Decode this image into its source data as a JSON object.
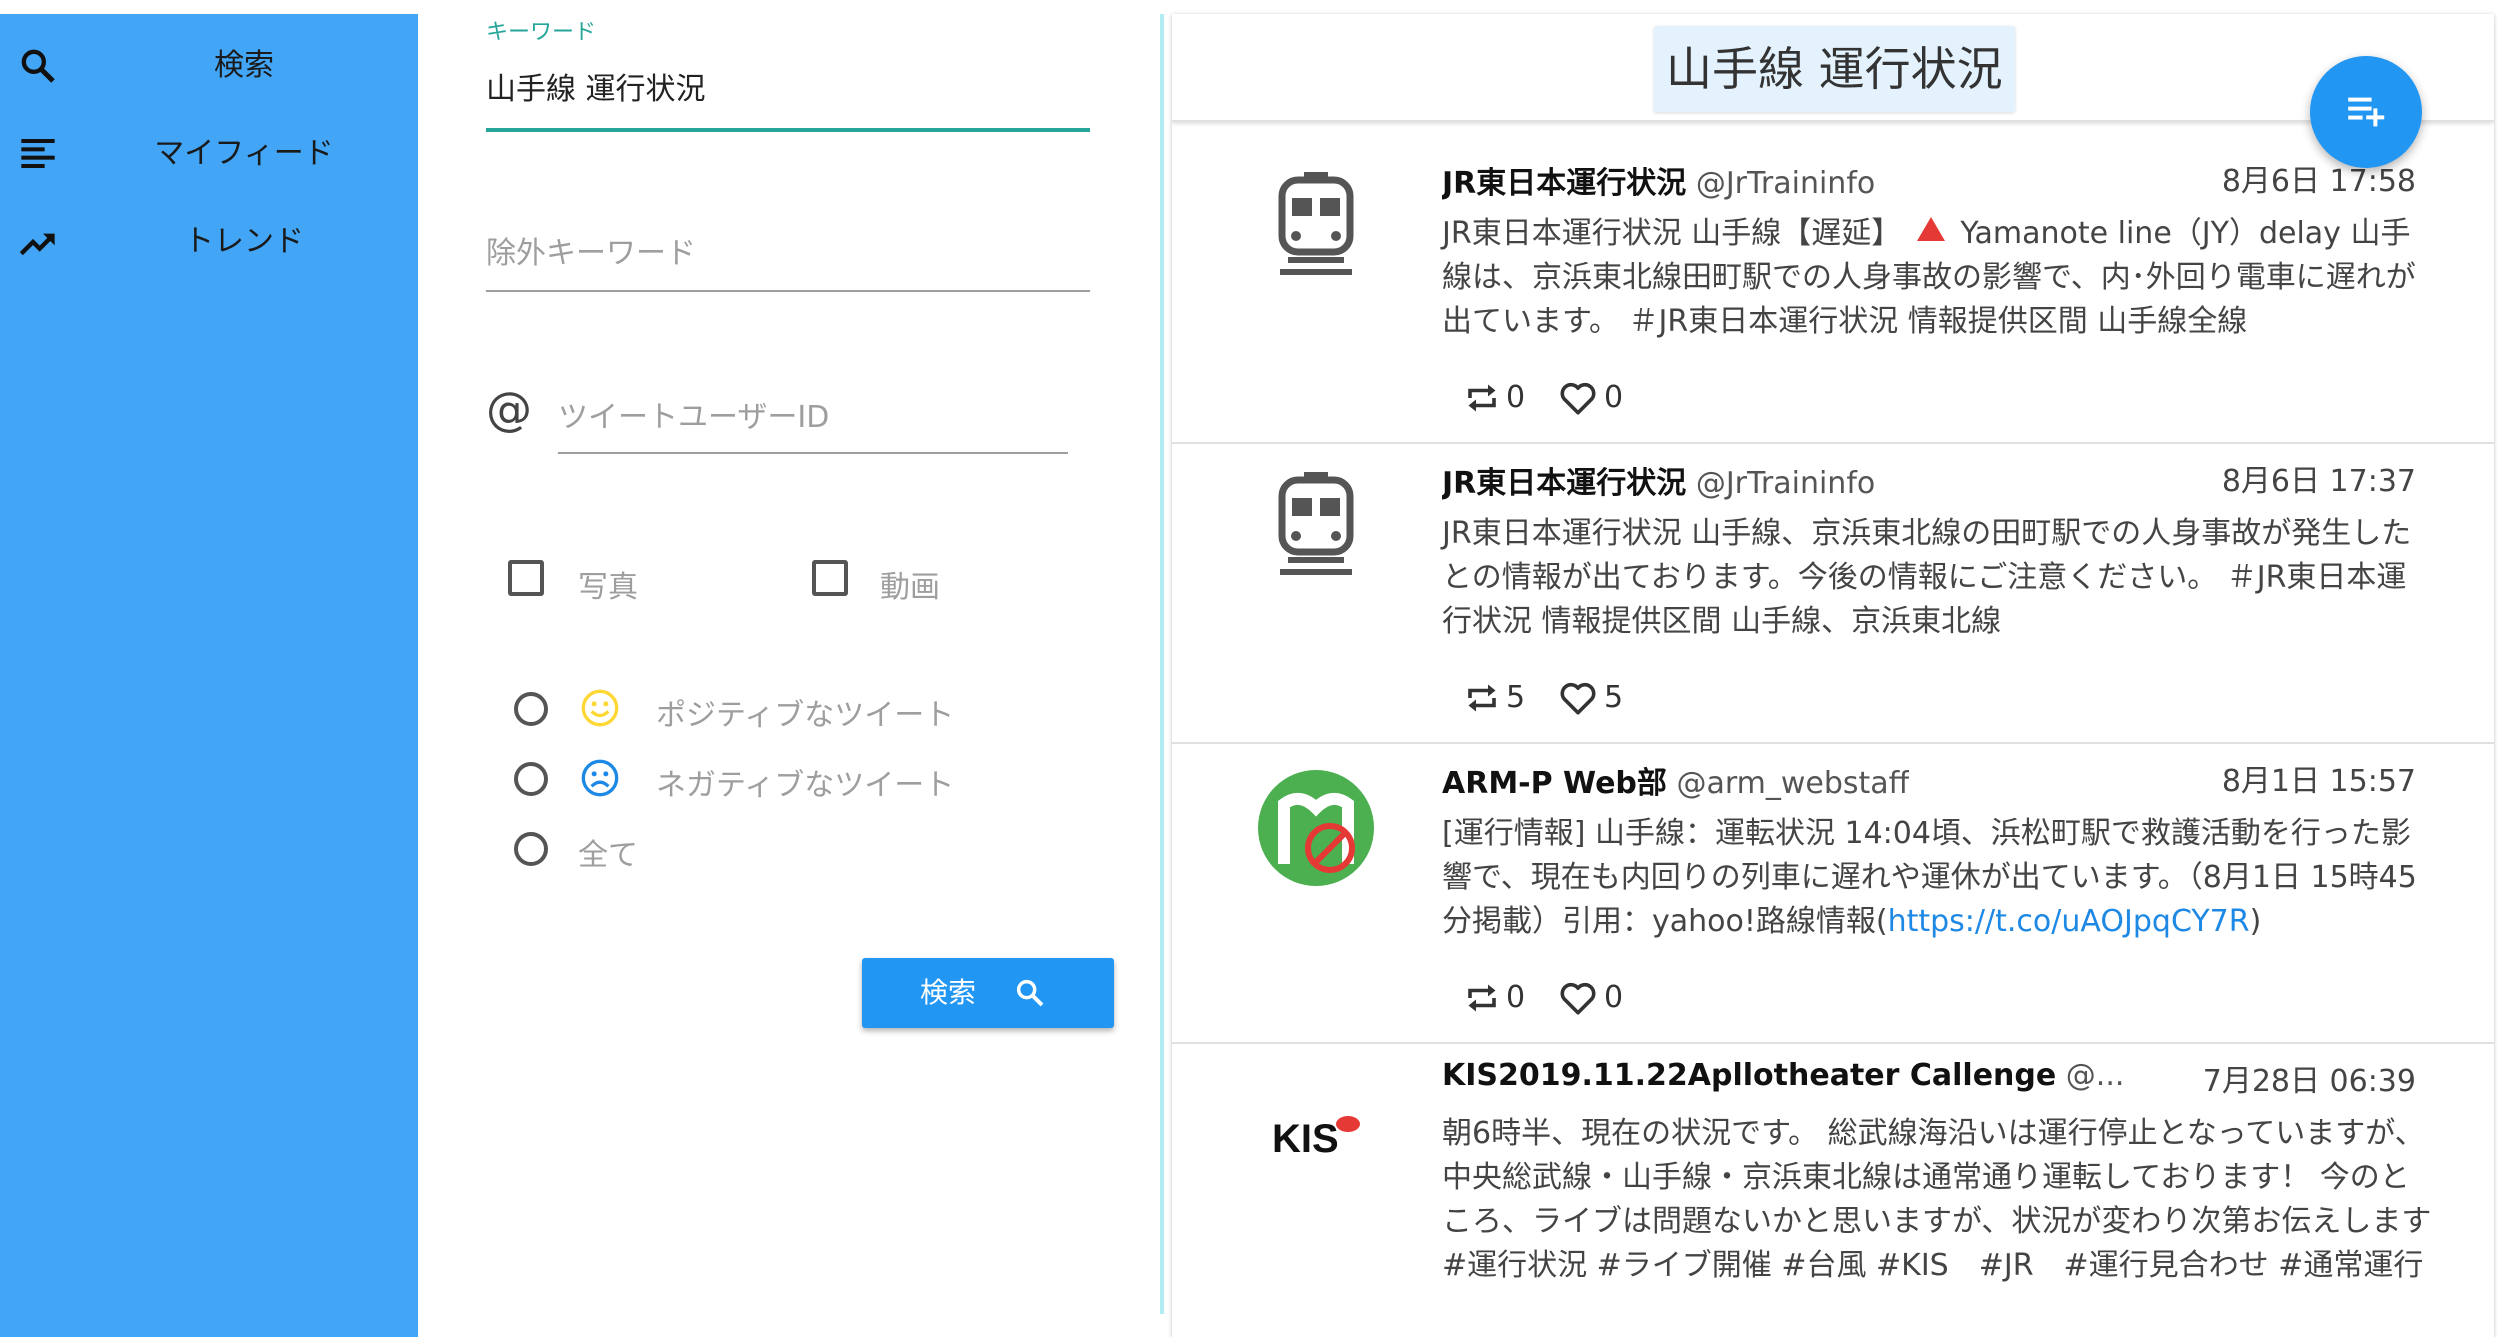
{
  "sidebar": {
    "items": [
      {
        "label": "検索",
        "icon": "search-icon"
      },
      {
        "label": "マイフィード",
        "icon": "feed-icon"
      },
      {
        "label": "トレンド",
        "icon": "trending-icon"
      }
    ]
  },
  "form": {
    "keyword": {
      "label": "キーワード",
      "value": "山手線 運行状況"
    },
    "exclude": {
      "placeholder": "除外キーワード"
    },
    "user_id": {
      "prefix": "@",
      "placeholder": "ツイートユーザーID"
    },
    "checkboxes": [
      {
        "label": "写真",
        "checked": false
      },
      {
        "label": "動画",
        "checked": false
      }
    ],
    "sentiment": [
      {
        "label": "ポジティブなツイート",
        "icon": "smile-icon"
      },
      {
        "label": "ネガティブなツイート",
        "icon": "sad-icon"
      },
      {
        "label": "全て"
      }
    ],
    "search_button": "検索"
  },
  "panel": {
    "title": "山手線 運行状況",
    "fab_icon": "playlist-add-icon"
  },
  "tweets": [
    {
      "name": "JR東日本運行状況",
      "user": "@JrTraininfo",
      "date": "8月6日 17:58",
      "avatar": "train-icon",
      "text_a": "JR東日本運行状況 山手線【遅延】",
      "text_b": "Yamanote line（JY）delay 山手線は、京浜東北線田町駅での人身事故の影響で、内･外回り電車に遅れが出ています。 ＃JR東日本運行状況 情報提供区間 山手線全線",
      "retweets": "0",
      "likes": "0"
    },
    {
      "name": "JR東日本運行状況",
      "user": "@JrTraininfo",
      "date": "8月6日 17:37",
      "avatar": "train-icon",
      "text": "JR東日本運行状況 山手線、京浜東北線の田町駅での人身事故が発生したとの情報が出ております。今後の情報にご注意ください。 ＃JR東日本運行状況 情報提供区間 山手線、京浜東北線",
      "retweets": "5",
      "likes": "5"
    },
    {
      "name": "ARM-P Web部",
      "user": "@arm_webstaff",
      "date": "8月1日 15:57",
      "avatar": "arm-logo",
      "text": "[運行情報] 山手線：運転状況 14:04頃、浜松町駅で救護活動を行った影響で、現在も内回りの列車に遅れや運休が出ています。（8月1日 15時45分掲載）引用：yahoo!路線情報(",
      "link": "https://t.co/uAOJpqCY7R",
      "text_end": ")",
      "retweets": "0",
      "likes": "0"
    },
    {
      "name": "KIS2019.11.22Apllotheater Callenge",
      "user": "@...",
      "date": "7月28日 06:39",
      "avatar": "kis-logo",
      "avatar_text": "KIS",
      "text": "朝6時半、現在の状況です。 総武線海沿いは運行停止となっていますが、中央総武線・山手線・京浜東北線は通常通り運転しております！ 今のところ、ライブは問題ないかと思いますが、状況が変わり次第お伝えします #運行状況 #ライブ開催 #台風 #KIS　#JR　#運行見合わせ #通常運行",
      "retweets": "",
      "likes": ""
    }
  ],
  "colors": {
    "sidebar": "#42a5f5",
    "accent": "#26a69a",
    "primary": "#2196f3",
    "link": "#1e88e5"
  }
}
